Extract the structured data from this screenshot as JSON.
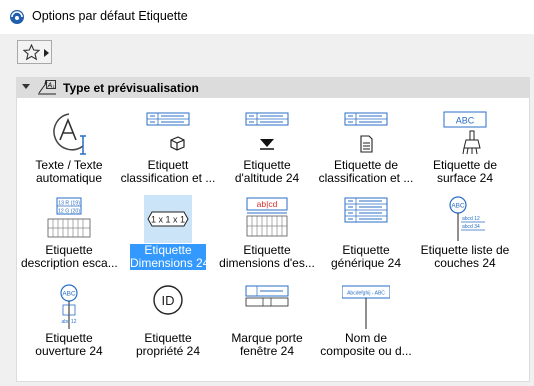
{
  "window": {
    "title": "Options par défaut Etiquette"
  },
  "section": {
    "title": "Type et prévisualisation"
  },
  "colors": {
    "selection": "#3399ff",
    "selection_bg": "#cce4f7",
    "accent_blue": "#2a6ec6",
    "tag_red": "#d6302a"
  },
  "items": [
    {
      "line1": "Texte / Texte",
      "line2": "automatique",
      "icon": "auto-text-icon"
    },
    {
      "line1": "Etiquett",
      "line2": "classification et ...",
      "icon": "classification-label-icon"
    },
    {
      "line1": "Etiquette",
      "line2": "d'altitude 24",
      "icon": "elevation-label-icon"
    },
    {
      "line1": "Etiquette de",
      "line2": "classification et ...",
      "icon": "classification-document-icon"
    },
    {
      "line1": "Etiquette de",
      "line2": "surface 24",
      "icon": "surface-label-icon"
    },
    {
      "line1": "Etiquette",
      "line2": "description esca...",
      "icon": "stair-description-icon"
    },
    {
      "line1": "Etiquette",
      "line2": "Dimensions 24",
      "icon": "dimensions-label-icon",
      "selected": true
    },
    {
      "line1": "Etiquette",
      "line2": "dimensions d'es...",
      "icon": "stair-dimensions-icon"
    },
    {
      "line1": "Etiquette",
      "line2": "générique 24",
      "icon": "generic-label-icon"
    },
    {
      "line1": "Etiquette liste de",
      "line2": "couches 24",
      "icon": "layer-list-icon"
    },
    {
      "line1": "Etiquette",
      "line2": "ouverture 24",
      "icon": "opening-label-icon"
    },
    {
      "line1": "Etiquette",
      "line2": "propriété 24",
      "icon": "property-label-icon"
    },
    {
      "line1": "Marque porte",
      "line2": "fenêtre 24",
      "icon": "door-window-marker-icon"
    },
    {
      "line1": "Nom de",
      "line2": "composite ou d...",
      "icon": "composite-name-icon"
    }
  ],
  "icon_text": {
    "surface": "ABC",
    "dimensions": "1 x 1 x 1",
    "stair_desc_1": "13 R (19)",
    "stair_desc_2": "12 G (20)",
    "stair_dim": "ab|cd",
    "layer_abc": "ABC",
    "layer_row1": "abcd  12",
    "layer_row2": "abcd  34",
    "opening_abc": "ABC",
    "opening_sub": "abc 12",
    "property": "ID",
    "composite": "Abcdefghij - ABC"
  }
}
